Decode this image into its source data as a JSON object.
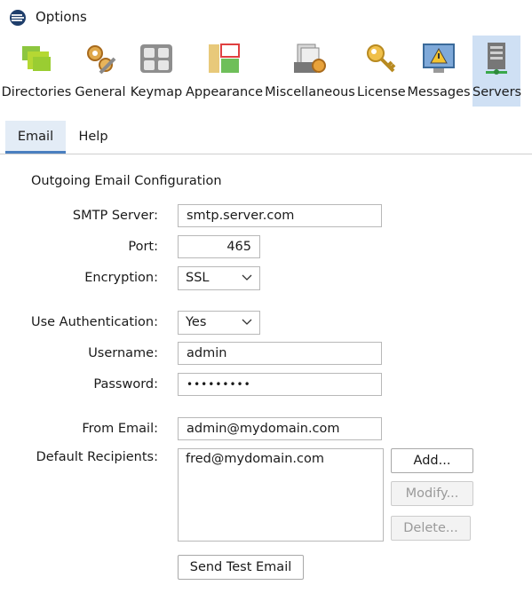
{
  "window": {
    "title": "Options"
  },
  "toolbar": {
    "items": [
      {
        "label": "Directories",
        "icon": "folders-icon"
      },
      {
        "label": "General",
        "icon": "gears-wrench-icon"
      },
      {
        "label": "Keymap",
        "icon": "keyboard-icon"
      },
      {
        "label": "Appearance",
        "icon": "appearance-icon"
      },
      {
        "label": "Miscellaneous",
        "icon": "documents-gear-icon"
      },
      {
        "label": "License",
        "icon": "key-icon"
      },
      {
        "label": "Messages",
        "icon": "warning-monitor-icon"
      },
      {
        "label": "Servers",
        "icon": "server-icon"
      }
    ],
    "selected": "Servers"
  },
  "tabs": [
    {
      "label": "Email",
      "active": true
    },
    {
      "label": "Help",
      "active": false
    }
  ],
  "form": {
    "section_title": "Outgoing Email Configuration",
    "smtp_server": {
      "label": "SMTP Server:",
      "value": "smtp.server.com"
    },
    "port": {
      "label": "Port:",
      "value": "465"
    },
    "encryption": {
      "label": "Encryption:",
      "value": "SSL"
    },
    "use_authentication": {
      "label": "Use Authentication:",
      "value": "Yes"
    },
    "username": {
      "label": "Username:",
      "value": "admin"
    },
    "password": {
      "label": "Password:",
      "value": "•••••••••"
    },
    "from_email": {
      "label": "From Email:",
      "value": "admin@mydomain.com"
    },
    "default_recipients": {
      "label": "Default Recipients:",
      "items": [
        "fred@mydomain.com"
      ]
    }
  },
  "buttons": {
    "add": "Add...",
    "modify": "Modify...",
    "delete": "Delete...",
    "send_test": "Send Test Email"
  },
  "colors": {
    "selected_bg": "#cfe0f4",
    "tab_active_bg": "#e3ecf6",
    "tab_underline": "#4a7fc0"
  }
}
